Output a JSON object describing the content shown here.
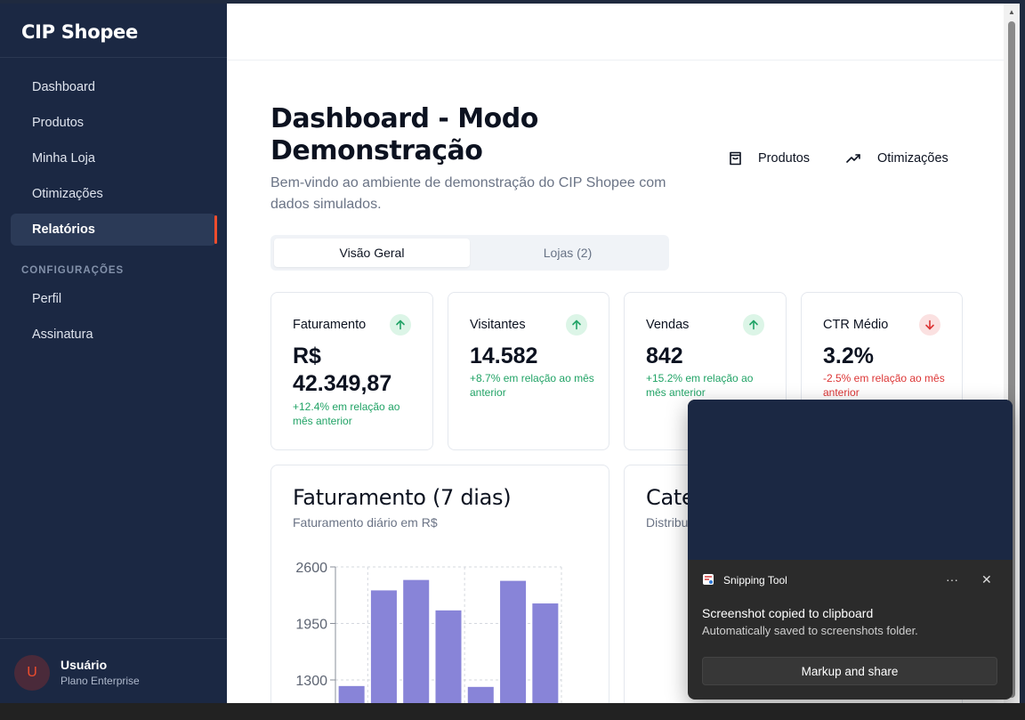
{
  "sidebar": {
    "brand": "CIP Shopee",
    "nav": [
      "Dashboard",
      "Produtos",
      "Minha Loja",
      "Otimizações",
      "Relatórios"
    ],
    "active_index": 4,
    "section_label": "CONFIGURAÇÕES",
    "settings": [
      "Perfil",
      "Assinatura"
    ],
    "user": {
      "initial": "U",
      "name": "Usuário",
      "plan": "Plano Enterprise"
    }
  },
  "header": {
    "title": "Dashboard - Modo Demonstração",
    "subtitle": "Bem-vindo ao ambiente de demonstração do CIP Shopee com dados simulados.",
    "buttons": [
      {
        "label": "Produtos",
        "icon": "shopping-bag-icon"
      },
      {
        "label": "Otimizações",
        "icon": "trending-up-icon"
      }
    ]
  },
  "tabs": [
    {
      "label": "Visão Geral",
      "active": true
    },
    {
      "label": "Lojas (2)",
      "active": false
    }
  ],
  "kpis": [
    {
      "label": "Faturamento",
      "value": "R$ 42.349,87",
      "delta": "+12.4% em relação ao mês anterior",
      "trend": "up",
      "icon": "arrow-up-icon"
    },
    {
      "label": "Visitantes",
      "value": "14.582",
      "delta": "+8.7% em relação ao mês anterior",
      "trend": "up",
      "icon": "arrow-up-icon"
    },
    {
      "label": "Vendas",
      "value": "842",
      "delta": "+15.2% em relação ao mês anterior",
      "trend": "up",
      "icon": "arrow-up-icon"
    },
    {
      "label": "CTR Médio",
      "value": "3.2%",
      "delta": "-2.5% em relação ao mês anterior",
      "trend": "down",
      "icon": "arrow-down-icon"
    }
  ],
  "colors": {
    "accent": "#ee4d2d",
    "up": "#21a366",
    "down": "#dc3535",
    "bar": "#8884d8"
  },
  "revenue_card": {
    "title": "Faturamento (7 dias)",
    "subtitle": "Faturamento diário em R$"
  },
  "category_card": {
    "title": "Cate",
    "subtitle": "Distribu"
  },
  "chart_data": {
    "type": "bar",
    "values": [
      1230,
      2330,
      2450,
      2100,
      1220,
      2440,
      2180
    ],
    "yticks": [
      "1300",
      "1950",
      "2600"
    ],
    "ylim": [
      1300,
      2600
    ],
    "grid": true
  },
  "toast": {
    "app": "Snipping Tool",
    "title": "Screenshot copied to clipboard",
    "message": "Automatically saved to screenshots folder.",
    "button": "Markup and share"
  }
}
